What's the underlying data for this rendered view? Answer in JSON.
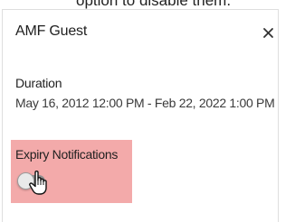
{
  "caption": {
    "text": "option to disable them."
  },
  "dialog": {
    "title": "AMF Guest",
    "close_glyph": "×",
    "close_icon": "close-icon"
  },
  "duration": {
    "label": "Duration",
    "value": "May 16, 2012 12:00 PM - Feb 22, 2022 1:00 PM"
  },
  "expiry": {
    "label": "Expiry Notifications",
    "toggle_state": "off",
    "highlight_color": "#f3aaaa"
  },
  "cursor": {
    "icon": "hand-pointer-icon"
  }
}
